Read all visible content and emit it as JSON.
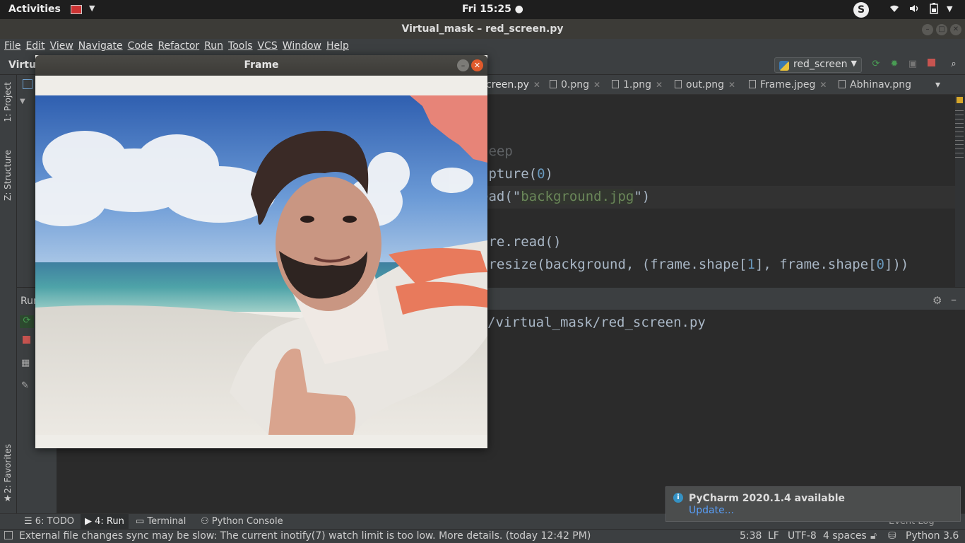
{
  "topbar": {
    "activities": "Activities",
    "clock": "Fri 15:25 ●",
    "skype_letter": "S"
  },
  "window": {
    "title": "Virtual_mask – red_screen.py"
  },
  "menu": [
    "File",
    "Edit",
    "View",
    "Navigate",
    "Code",
    "Refactor",
    "Run",
    "Tools",
    "VCS",
    "Window",
    "Help"
  ],
  "nav": {
    "project_crumb": "Virtu",
    "run_config": "red_screen"
  },
  "left_tabs": {
    "project": "1: Project",
    "structure": "Z: Structure",
    "favorites": "2: Favorites"
  },
  "editor_tabs": [
    {
      "label": "creen.py",
      "active": true
    },
    {
      "label": "0.png"
    },
    {
      "label": "1.png"
    },
    {
      "label": "out.png"
    },
    {
      "label": "Frame.jpeg"
    },
    {
      "label": "Abhinav.png"
    }
  ],
  "code": {
    "line1": "leep",
    "line2_a": "apture(",
    "line2_num": "0",
    "line2_b": ")",
    "line3_a": "ead(\"",
    "line3_str": "background.jpg",
    "line3_b": "\")",
    "line4": "ure.read()",
    "line5_a": ".resize(background, (frame.shape[",
    "line5_n1": "1",
    "line5_b": "], frame.shape[",
    "line5_n2": "0",
    "line5_c": "]))"
  },
  "run_panel": {
    "header": "Run",
    "console_line": "/virtual_mask/red_screen.py"
  },
  "bottom_tools": {
    "todo": "6: TODO",
    "run": "4: Run",
    "terminal": "Terminal",
    "python_console": "Python Console",
    "event_log": "Event Log"
  },
  "status": {
    "message": "External file changes sync may be slow: The current inotify(7) watch limit is too low. More details. (today 12:42 PM)",
    "position": "5:38",
    "line_sep": "LF",
    "encoding": "UTF-8",
    "indent": "4 spaces",
    "interpreter": "Python 3.6"
  },
  "notification": {
    "title": "PyCharm 2020.1.4 available",
    "link": "Update..."
  },
  "frame_window": {
    "title": "Frame"
  },
  "colors": {
    "ide_bg": "#2b2b2b",
    "panel": "#3c3f41",
    "accent_red": "#c75450",
    "accent_green": "#499c54",
    "link": "#589df6"
  }
}
